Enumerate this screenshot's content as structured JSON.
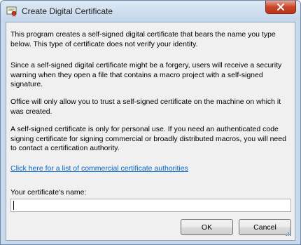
{
  "window": {
    "title": "Create Digital Certificate",
    "title_icon": "certificate-icon",
    "close_icon": "close-icon"
  },
  "content": {
    "paragraphs": [
      "This program creates a self-signed digital certificate that bears the name you type below. This type of certificate does not verify your identity.",
      "Since a self-signed digital certificate might be a forgery, users will receive a security warning when they open a file that contains a macro project with a self-signed signature.",
      "Office will only allow you to trust a self-signed certificate on the machine on which it was created.",
      "A self-signed certificate is only for personal use. If you need an authenticated code signing certificate for signing commercial or broadly distributed macros, you will need to contact a certification authority."
    ],
    "link_text": "Click here for a list of commercial certificate authorities",
    "name_label": "Your certificate's name:",
    "name_value": ""
  },
  "buttons": {
    "ok": "OK",
    "cancel": "Cancel"
  },
  "colors": {
    "link": "#0066cc",
    "close_button": "#c9452a",
    "frame": "#c9d9ec"
  }
}
